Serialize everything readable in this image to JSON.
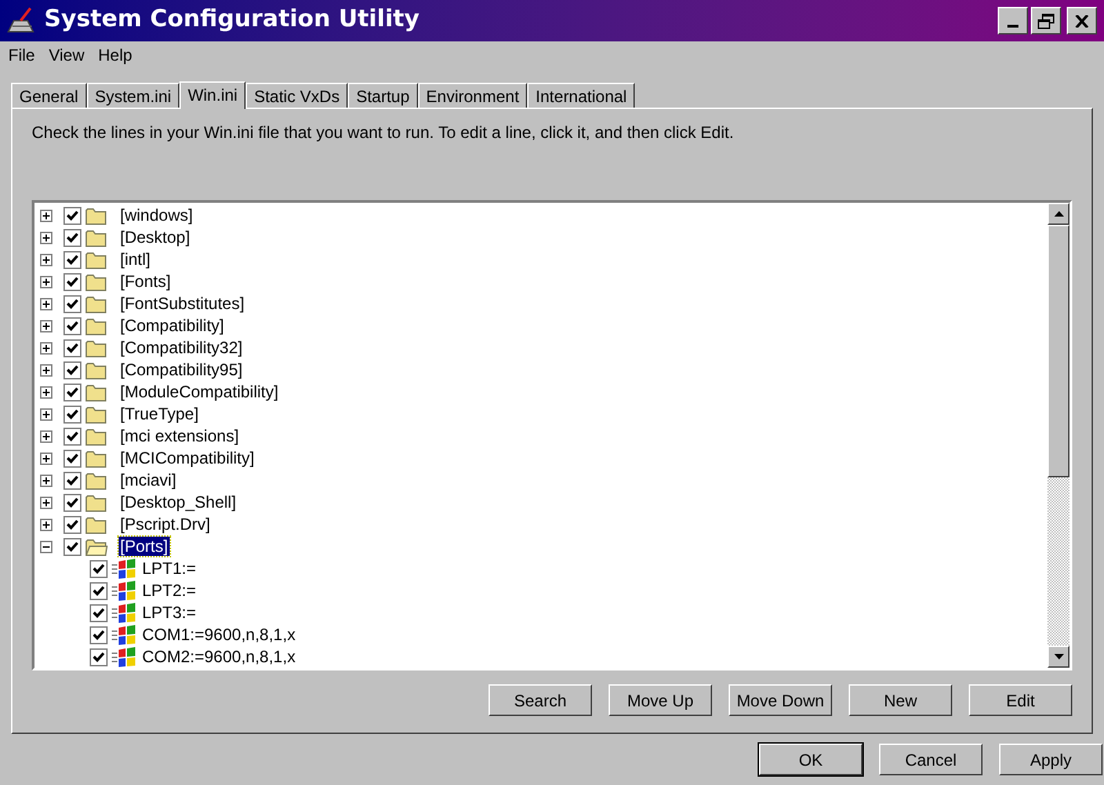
{
  "window": {
    "title": "System Configuration Utility"
  },
  "menu": [
    "File",
    "View",
    "Help"
  ],
  "tabs": [
    {
      "label": "General",
      "selected": false
    },
    {
      "label": "System.ini",
      "selected": false
    },
    {
      "label": "Win.ini",
      "selected": true
    },
    {
      "label": "Static VxDs",
      "selected": false
    },
    {
      "label": "Startup",
      "selected": false
    },
    {
      "label": "Environment",
      "selected": false
    },
    {
      "label": "International",
      "selected": false
    }
  ],
  "instructions": "Check the lines in your Win.ini file that you want to run. To edit a line, click it, and then click Edit.",
  "tree": [
    {
      "label": "[windows]",
      "checked": true,
      "expanded": false,
      "selected": false
    },
    {
      "label": "[Desktop]",
      "checked": true,
      "expanded": false,
      "selected": false
    },
    {
      "label": "[intl]",
      "checked": true,
      "expanded": false,
      "selected": false
    },
    {
      "label": "[Fonts]",
      "checked": true,
      "expanded": false,
      "selected": false
    },
    {
      "label": "[FontSubstitutes]",
      "checked": true,
      "expanded": false,
      "selected": false
    },
    {
      "label": "[Compatibility]",
      "checked": true,
      "expanded": false,
      "selected": false
    },
    {
      "label": "[Compatibility32]",
      "checked": true,
      "expanded": false,
      "selected": false
    },
    {
      "label": "[Compatibility95]",
      "checked": true,
      "expanded": false,
      "selected": false
    },
    {
      "label": "[ModuleCompatibility]",
      "checked": true,
      "expanded": false,
      "selected": false
    },
    {
      "label": "[TrueType]",
      "checked": true,
      "expanded": false,
      "selected": false
    },
    {
      "label": "[mci extensions]",
      "checked": true,
      "expanded": false,
      "selected": false
    },
    {
      "label": "[MCICompatibility]",
      "checked": true,
      "expanded": false,
      "selected": false
    },
    {
      "label": "[mciavi]",
      "checked": true,
      "expanded": false,
      "selected": false
    },
    {
      "label": "[Desktop_Shell]",
      "checked": true,
      "expanded": false,
      "selected": false
    },
    {
      "label": "[Pscript.Drv]",
      "checked": true,
      "expanded": false,
      "selected": false
    },
    {
      "label": "[Ports]",
      "checked": true,
      "expanded": true,
      "selected": true,
      "children": [
        {
          "label": "LPT1:=",
          "checked": true,
          "selected": false
        },
        {
          "label": "LPT2:=",
          "checked": true,
          "selected": false
        },
        {
          "label": "LPT3:=",
          "checked": true,
          "selected": false
        },
        {
          "label": "COM1:=9600,n,8,1,x",
          "checked": true,
          "selected": false
        },
        {
          "label": "COM2:=9600,n,8,1,x",
          "checked": true,
          "selected": false
        }
      ]
    }
  ],
  "list_buttons": [
    "Search",
    "Move Up",
    "Move Down",
    "New",
    "Edit"
  ],
  "dialog_buttons": [
    {
      "label": "OK",
      "default": true
    },
    {
      "label": "Cancel",
      "default": false
    },
    {
      "label": "Apply",
      "default": false
    }
  ]
}
